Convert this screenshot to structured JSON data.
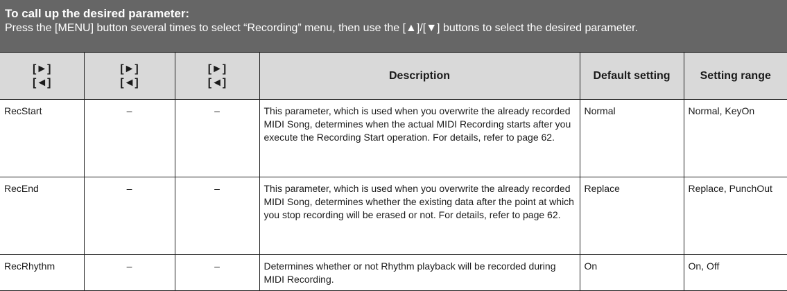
{
  "banner": {
    "title": "To call up the desired parameter:",
    "subtitle": "Press the [MENU] button several times to select “Recording” menu, then use the [▲]/[▼] buttons to select the desired parameter."
  },
  "table": {
    "headers": [
      {
        "line1": "[►]",
        "line2": "[◄]"
      },
      {
        "line1": "[►]",
        "line2": "[◄]"
      },
      {
        "line1": "[►]",
        "line2": "[◄]"
      },
      {
        "label": "Description"
      },
      {
        "label": "Default setting"
      },
      {
        "label": "Setting range"
      }
    ],
    "rows": [
      {
        "param": "RecStart",
        "col2": "–",
        "col3": "–",
        "description": "This parameter, which is used when you overwrite the already recorded MIDI Song, determines when the actual MIDI Recording starts after you execute the Recording Start operation. For details, refer to page 62.",
        "default": "Normal",
        "range": "Normal, KeyOn"
      },
      {
        "param": "RecEnd",
        "col2": "–",
        "col3": "–",
        "description": "This parameter, which is used when you overwrite the already recorded MIDI Song, determines whether the existing data after the point at which you stop recording will be erased or not. For details, refer to page 62.",
        "default": "Replace",
        "range": "Replace, PunchOut"
      },
      {
        "param": "RecRhythm",
        "col2": "–",
        "col3": "–",
        "description": "Determines whether or not Rhythm playback will be recorded during MIDI Recording.",
        "default": "On",
        "range": "On, Off"
      }
    ]
  }
}
